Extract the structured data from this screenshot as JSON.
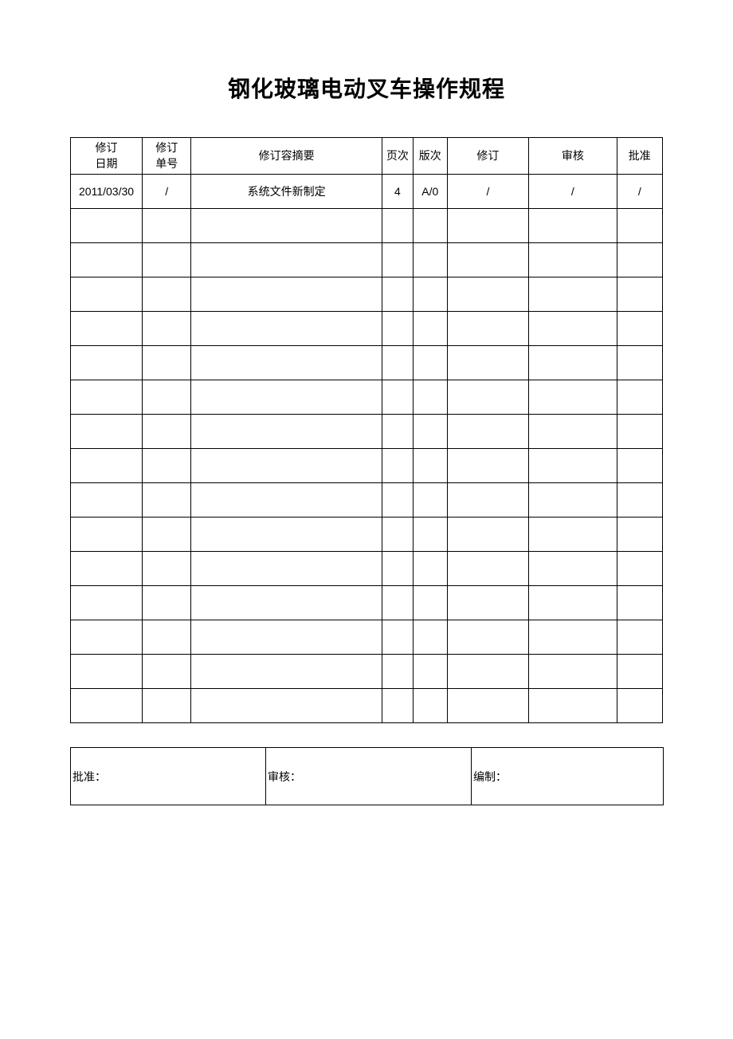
{
  "title": "钢化玻璃电动叉车操作规程",
  "headers": {
    "date": "修订\n日期",
    "order": "修订\n单号",
    "summary": "修订容摘要",
    "page": "页次",
    "version": "版次",
    "revision": "修订",
    "audit": "审核",
    "approve": "批准"
  },
  "rows": [
    {
      "date": "2011/03/30",
      "order": "/",
      "summary": "系统文件新制定",
      "page": "4",
      "version": "A/0",
      "revision": "/",
      "audit": "/",
      "approve": "/"
    },
    {
      "date": "",
      "order": "",
      "summary": "",
      "page": "",
      "version": "",
      "revision": "",
      "audit": "",
      "approve": ""
    },
    {
      "date": "",
      "order": "",
      "summary": "",
      "page": "",
      "version": "",
      "revision": "",
      "audit": "",
      "approve": ""
    },
    {
      "date": "",
      "order": "",
      "summary": "",
      "page": "",
      "version": "",
      "revision": "",
      "audit": "",
      "approve": ""
    },
    {
      "date": "",
      "order": "",
      "summary": "",
      "page": "",
      "version": "",
      "revision": "",
      "audit": "",
      "approve": ""
    },
    {
      "date": "",
      "order": "",
      "summary": "",
      "page": "",
      "version": "",
      "revision": "",
      "audit": "",
      "approve": ""
    },
    {
      "date": "",
      "order": "",
      "summary": "",
      "page": "",
      "version": "",
      "revision": "",
      "audit": "",
      "approve": ""
    },
    {
      "date": "",
      "order": "",
      "summary": "",
      "page": "",
      "version": "",
      "revision": "",
      "audit": "",
      "approve": ""
    },
    {
      "date": "",
      "order": "",
      "summary": "",
      "page": "",
      "version": "",
      "revision": "",
      "audit": "",
      "approve": ""
    },
    {
      "date": "",
      "order": "",
      "summary": "",
      "page": "",
      "version": "",
      "revision": "",
      "audit": "",
      "approve": ""
    },
    {
      "date": "",
      "order": "",
      "summary": "",
      "page": "",
      "version": "",
      "revision": "",
      "audit": "",
      "approve": ""
    },
    {
      "date": "",
      "order": "",
      "summary": "",
      "page": "",
      "version": "",
      "revision": "",
      "audit": "",
      "approve": ""
    },
    {
      "date": "",
      "order": "",
      "summary": "",
      "page": "",
      "version": "",
      "revision": "",
      "audit": "",
      "approve": ""
    },
    {
      "date": "",
      "order": "",
      "summary": "",
      "page": "",
      "version": "",
      "revision": "",
      "audit": "",
      "approve": ""
    },
    {
      "date": "",
      "order": "",
      "summary": "",
      "page": "",
      "version": "",
      "revision": "",
      "audit": "",
      "approve": ""
    },
    {
      "date": "",
      "order": "",
      "summary": "",
      "page": "",
      "version": "",
      "revision": "",
      "audit": "",
      "approve": ""
    }
  ],
  "signoff": {
    "approve": "批准：",
    "audit": "审核：",
    "compile": "编制："
  }
}
